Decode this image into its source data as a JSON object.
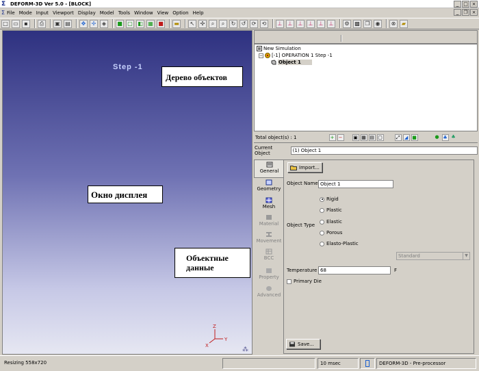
{
  "window": {
    "title": "DEFORM-3D  Ver 5.0 - [BLOCK]",
    "app_icon": "deform-logo-icon",
    "controls": {
      "minimize": "_",
      "maximize": "□",
      "close": "×"
    },
    "mdi_controls": {
      "minimize": "_",
      "restore": "❐",
      "close": "×"
    }
  },
  "menu": {
    "items": [
      "File",
      "Mode",
      "Input",
      "Viewport",
      "Display",
      "Model",
      "Tools",
      "Window",
      "View",
      "Option",
      "Help"
    ]
  },
  "display": {
    "step_label": "Step  -1",
    "callouts": {
      "tree": "Дерево объектов",
      "display": "Окно дисплея",
      "object_data_line1": "Объектные",
      "object_data_line2": "данные"
    },
    "axes": {
      "z": "Z",
      "x": "X",
      "y": "Y"
    }
  },
  "tree": {
    "root": "New Simulation",
    "operation": "[-1] OPERATION 1  Step -1",
    "object": "Object 1"
  },
  "total_bar": {
    "label": "Total object(s) :  1"
  },
  "current_object": {
    "label": "Current Object",
    "value": "(1) Object 1"
  },
  "sidetabs": [
    {
      "label": "General",
      "state": "active"
    },
    {
      "label": "Geometry",
      "state": "enabled"
    },
    {
      "label": "Mesh",
      "state": "enabled"
    },
    {
      "label": "Material",
      "state": "disabled"
    },
    {
      "label": "Movement",
      "state": "disabled"
    },
    {
      "label": "BCC",
      "state": "disabled"
    },
    {
      "label": "Property",
      "state": "disabled"
    },
    {
      "label": "Advanced",
      "state": "disabled"
    }
  ],
  "form": {
    "import_label": "Import...",
    "object_name_label": "Object Name",
    "object_name_value": "Object 1",
    "object_type_label": "Object Type",
    "types": [
      "Rigid",
      "Plastic",
      "Elastic",
      "Porous",
      "Elasto-Plastic"
    ],
    "selected_type": "Rigid",
    "standard_value": "Standard",
    "temperature_label": "Temperature",
    "temperature_value": "68",
    "temperature_unit": "F",
    "primary_die_label": "Primary Die",
    "save_label": "Save..."
  },
  "status": {
    "resizing": "Resizing  558x720",
    "time": "10 msec",
    "mode": "DEFORM-3D  -  Pre-processor"
  },
  "colors": {
    "display_top": "#2e3180",
    "display_bottom": "#e6e7f2",
    "step_text": "#c7d2ff",
    "panel": "#d4d0c8"
  }
}
